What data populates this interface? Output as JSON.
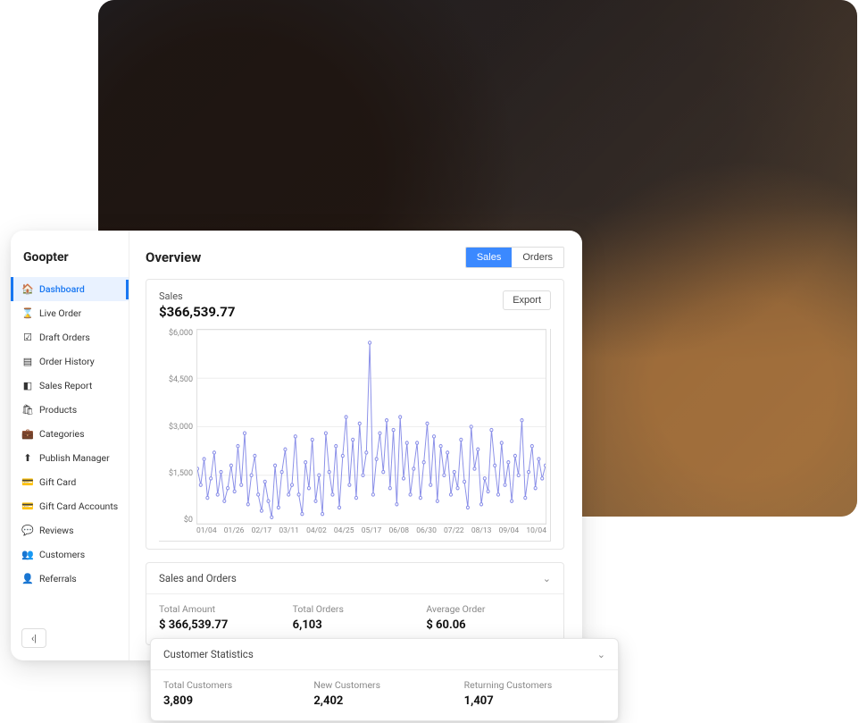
{
  "brand": "Goopter",
  "sidebar": {
    "items": [
      {
        "label": "Dashboard",
        "icon": "🏠"
      },
      {
        "label": "Live Order",
        "icon": "⌛"
      },
      {
        "label": "Draft Orders",
        "icon": "☑"
      },
      {
        "label": "Order History",
        "icon": "▤"
      },
      {
        "label": "Sales Report",
        "icon": "◧"
      },
      {
        "label": "Products",
        "icon": "🛍"
      },
      {
        "label": "Categories",
        "icon": "💼"
      },
      {
        "label": "Publish Manager",
        "icon": "⬆"
      },
      {
        "label": "Gift Card",
        "icon": "💳"
      },
      {
        "label": "Gift Card Accounts",
        "icon": "💳"
      },
      {
        "label": "Reviews",
        "icon": "💬"
      },
      {
        "label": "Customers",
        "icon": "👥"
      },
      {
        "label": "Referrals",
        "icon": "👤"
      }
    ]
  },
  "header": {
    "title": "Overview",
    "tabs": {
      "sales": "Sales",
      "orders": "Orders"
    },
    "export": "Export"
  },
  "chart": {
    "label": "Sales",
    "value": "$366,539.77"
  },
  "chart_data": {
    "type": "line",
    "xlabel": "",
    "ylabel": "",
    "ylim": [
      0,
      6000
    ],
    "yticks": [
      "$6,000",
      "$4,500",
      "$3,000",
      "$1,500",
      "$0"
    ],
    "xticks": [
      "01/04",
      "01/26",
      "02/17",
      "03/11",
      "04/02",
      "04/25",
      "05/17",
      "06/08",
      "06/30",
      "07/22",
      "08/13",
      "09/04",
      "10/04"
    ],
    "values": [
      1700,
      1200,
      2000,
      800,
      1400,
      2200,
      900,
      1600,
      700,
      1100,
      1800,
      1000,
      2400,
      1200,
      2800,
      600,
      1500,
      2100,
      900,
      400,
      1300,
      700,
      200,
      1800,
      500,
      1600,
      2300,
      900,
      1200,
      2700,
      900,
      300,
      1900,
      1100,
      2600,
      700,
      1500,
      300,
      2800,
      1600,
      900,
      2400,
      500,
      2100,
      3300,
      1200,
      2600,
      800,
      3100,
      1500,
      2200,
      5600,
      900,
      2000,
      2800,
      1600,
      3200,
      1100,
      2900,
      600,
      3300,
      1400,
      2500,
      900,
      1700,
      2500,
      800,
      1900,
      3100,
      1200,
      2700,
      700,
      2400,
      1500,
      2200,
      900,
      1600,
      1100,
      2600,
      1300,
      500,
      3000,
      1700,
      2300,
      600,
      1400,
      1000,
      2900,
      1800,
      900,
      2500,
      1200,
      1900,
      700,
      2100,
      1500,
      3200,
      800,
      1600,
      2400,
      1100,
      2000,
      1400,
      1800
    ]
  },
  "sales_orders": {
    "title": "Sales and Orders",
    "total_amount_label": "Total Amount",
    "total_amount": "$ 366,539.77",
    "total_orders_label": "Total Orders",
    "total_orders": "6,103",
    "avg_label": "Average Order",
    "avg": "$ 60.06"
  },
  "customers": {
    "title": "Customer Statistics",
    "total_label": "Total Customers",
    "total": "3,809",
    "new_label": "New Customers",
    "new": "2,402",
    "ret_label": "Returning Customers",
    "ret": "1,407"
  }
}
